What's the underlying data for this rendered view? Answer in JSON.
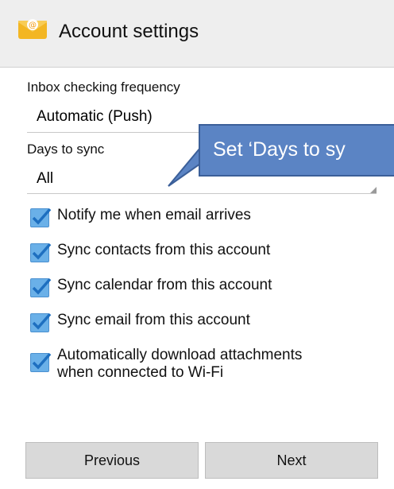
{
  "header": {
    "title": "Account settings",
    "icon": "email-app-icon"
  },
  "inbox_frequency": {
    "label": "Inbox checking frequency",
    "value": "Automatic (Push)"
  },
  "days_to_sync": {
    "label": "Days to sync",
    "value": "All"
  },
  "callout": {
    "text": "Set ‘Days to sy"
  },
  "options": [
    {
      "label": "Notify me when email arrives",
      "checked": true
    },
    {
      "label": "Sync contacts from this account",
      "checked": true
    },
    {
      "label": "Sync calendar from this account",
      "checked": true
    },
    {
      "label": "Sync email from this account",
      "checked": true
    },
    {
      "label_line1": "Automatically download attachments",
      "label_line2": "when connected to Wi-Fi",
      "checked": true
    }
  ],
  "buttons": {
    "previous": "Previous",
    "next": "Next"
  },
  "colors": {
    "checkbox": "#6ab0e8",
    "callout": "#5b84c4",
    "header_bg": "#eeeeee"
  }
}
